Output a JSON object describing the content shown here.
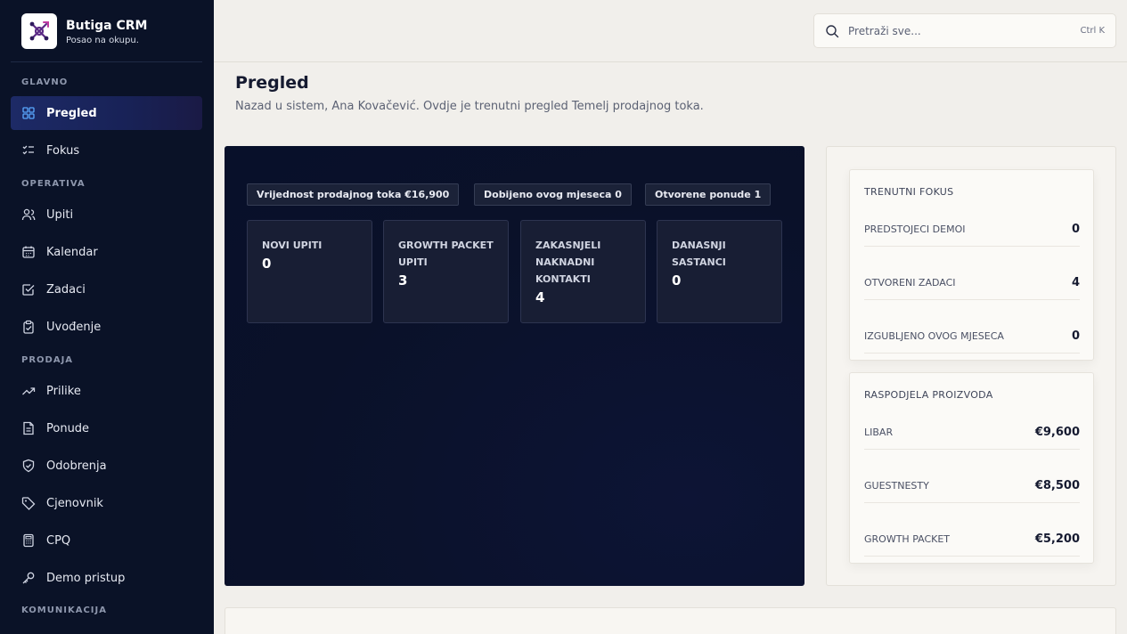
{
  "brand": {
    "name": "Butiga CRM",
    "tagline": "Posao na okupu."
  },
  "sidebar": {
    "sections": [
      {
        "label": "GLAVNO"
      },
      {
        "label": "OPERATIVA"
      },
      {
        "label": "PRODAJA"
      },
      {
        "label": "KOMUNIKACIJA"
      }
    ],
    "items": [
      {
        "label": "Pregled",
        "icon": "grid-icon",
        "active": true
      },
      {
        "label": "Fokus",
        "icon": "list-check-icon"
      },
      {
        "label": "Upiti",
        "icon": "users-icon"
      },
      {
        "label": "Kalendar",
        "icon": "calendar-icon"
      },
      {
        "label": "Zadaci",
        "icon": "checkbox-icon"
      },
      {
        "label": "Uvođenje",
        "icon": "clipboard-icon"
      },
      {
        "label": "Prilike",
        "icon": "trending-icon"
      },
      {
        "label": "Ponude",
        "icon": "document-icon"
      },
      {
        "label": "Odobrenja",
        "icon": "shield-check-icon"
      },
      {
        "label": "Cjenovnik",
        "icon": "tag-icon"
      },
      {
        "label": "CPQ",
        "icon": "calculator-icon"
      },
      {
        "label": "Demo pristup",
        "icon": "key-icon"
      }
    ]
  },
  "search": {
    "placeholder": "Pretraži sve...",
    "shortcut": "Ctrl K"
  },
  "header": {
    "title": "Pregled",
    "subtitle": "Nazad u sistem, Ana Kovačević. Ovdje je trenutni pregled Temelj prodajnog toka."
  },
  "overview": {
    "chips": [
      "Vrijednost prodajnog toka €16,900",
      "Dobijeno ovog mjeseca 0",
      "Otvorene ponude 1"
    ],
    "stats": [
      {
        "label": "NOVI UPITI",
        "value": "0"
      },
      {
        "label": "GROWTH PACKET UPITI",
        "value": "3"
      },
      {
        "label": "ZAKASNJELI NAKNADNI KONTAKTI",
        "value": "4"
      },
      {
        "label": "DANASNJI SASTANCI",
        "value": "0"
      }
    ]
  },
  "focus": {
    "title": "TRENUTNI FOKUS",
    "rows": [
      {
        "label": "PREDSTOJECI DEMOI",
        "value": "0"
      },
      {
        "label": "OTVORENI ZADACI",
        "value": "4"
      },
      {
        "label": "IZGUBLJENO OVOG MJESECA",
        "value": "0"
      }
    ]
  },
  "distribution": {
    "title": "RASPODJELA PROIZVODA",
    "rows": [
      {
        "label": "LIBAR",
        "value": "€9,600"
      },
      {
        "label": "GUESTNESTY",
        "value": "€8,500"
      },
      {
        "label": "GROWTH PACKET",
        "value": "€5,200"
      }
    ]
  },
  "colors": {
    "sidebar_bg": "#0a1227",
    "accent": "#1d2a66",
    "page_bg": "#f1efeb"
  }
}
